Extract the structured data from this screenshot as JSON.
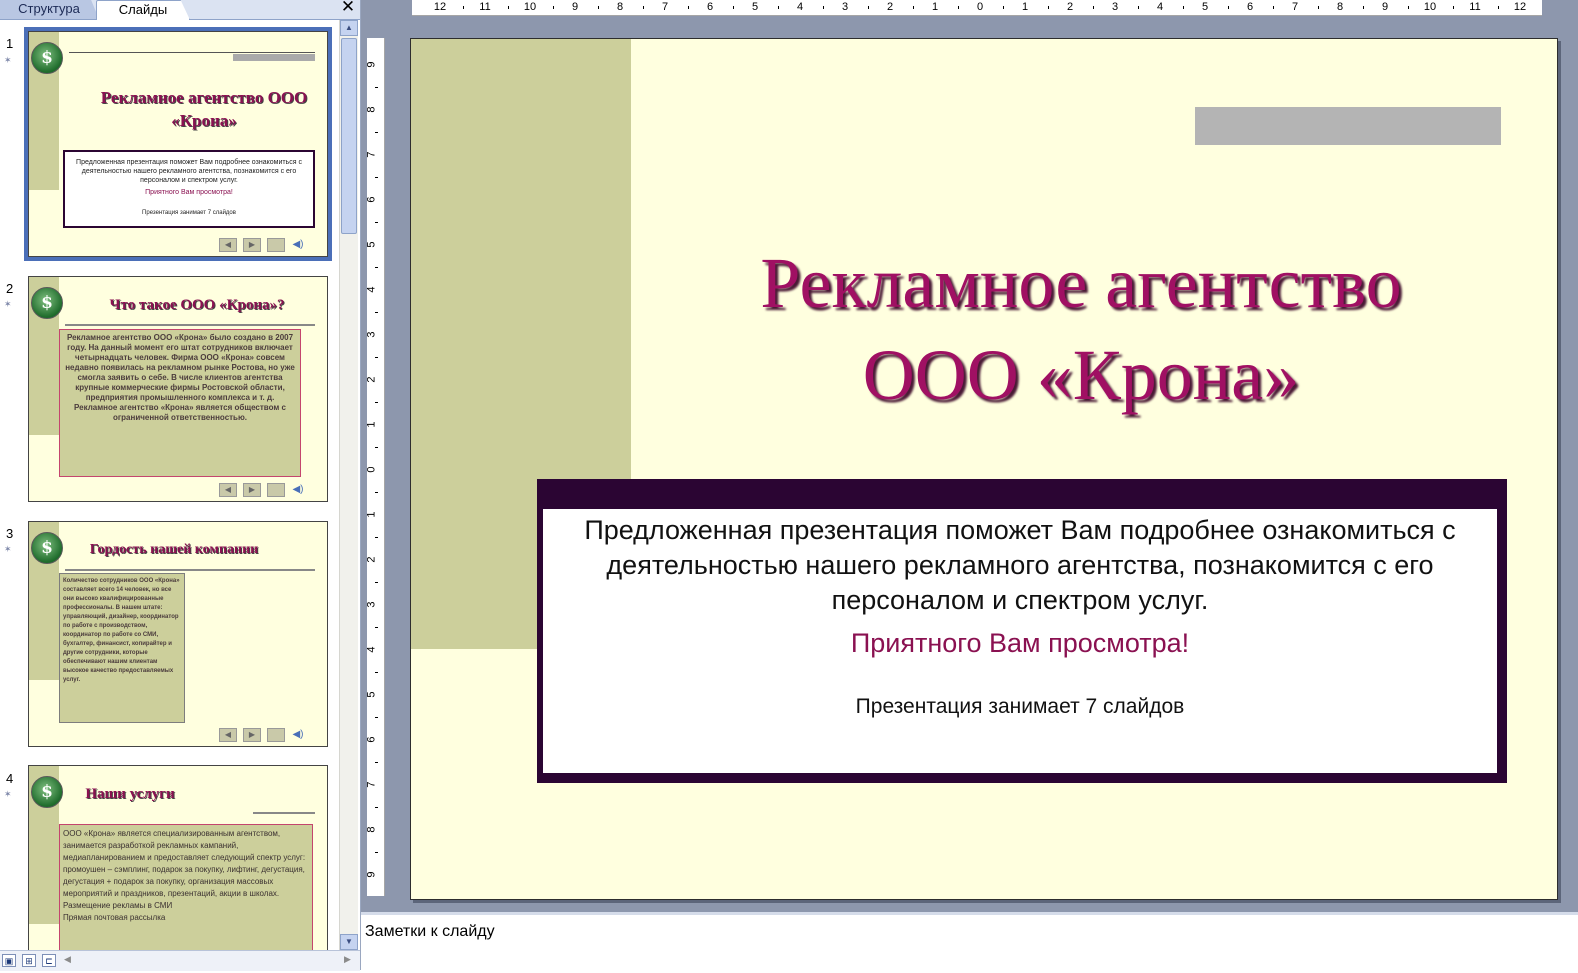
{
  "tabs": {
    "structure": "Структура",
    "slides": "Слайды",
    "close": "✕"
  },
  "thumbnails": [
    {
      "number": "1",
      "title": "Рекламное агентство ООО «Крона»",
      "desc": "Предложенная презентация поможет Вам подробнее ознакомиться с деятельностью нашего рекламного агентства, познакомится с его персоналом и спектром услуг.",
      "invite": "Приятного Вам просмотра!",
      "count": "Презентация занимает 7 слайдов"
    },
    {
      "number": "2",
      "title": "Что такое ООО «Крона»?",
      "body": "Рекламное агентство ООО «Крона» было создано в 2007 году. На данный момент его штат сотрудников включает четырнадцать человек. Фирма ООО «Крона» совсем недавно появилась на рекламном рынке Ростова, но уже смогла заявить о себе. В числе клиентов агентства крупные коммерческие фирмы Ростовской области, предприятия промышленного комплекса и т. д. Рекламное агентство «Крона» является обществом с ограниченной ответственностью."
    },
    {
      "number": "3",
      "title": "Гордость нашей компании",
      "body": "Количество сотрудников ООО «Крона» составляет всего 14 человек, но все они высоко квалифицированные профессионалы. В нашем штате: управляющий, дизайнер, координатор по работе с производством, координатор по работе со СМИ, бухгалтер, финансист, копирайтер и другие сотрудники, которые обеспечивают нашим клиентам высокое качество предоставляемых услуг."
    },
    {
      "number": "4",
      "title": "Наши услуги",
      "bullets": [
        "ООО «Крона» является специализированным агентством, занимается разработкой рекламных кампаний, медиапланированием и предоставляет следующий спектр услуг:",
        "промоушен – сэмплинг, подарок за покупку, лифтинг, дегустация, дегустация + подарок за покупку, организация массовых мероприятий и праздников, презентаций, акции в школах.",
        "Размещение рекламы в СМИ",
        "Прямая почтовая рассылка"
      ]
    }
  ],
  "ruler": {
    "horizontal": [
      "12",
      "11",
      "10",
      "9",
      "8",
      "7",
      "6",
      "5",
      "4",
      "3",
      "2",
      "1",
      "0",
      "1",
      "2",
      "3",
      "4",
      "5",
      "6",
      "7",
      "8",
      "9",
      "10",
      "11",
      "12"
    ],
    "vertical": [
      "9",
      "8",
      "7",
      "6",
      "5",
      "4",
      "3",
      "2",
      "1",
      "0",
      "1",
      "2",
      "3",
      "4",
      "5",
      "6",
      "7",
      "8",
      "9"
    ]
  },
  "slide": {
    "title_line1": "Рекламное агентство",
    "title_line2": "ООО «Крона»",
    "description": "Предложенная презентация поможет Вам подробнее ознакомиться с деятельностью нашего рекламного агентства, познакомится с его персоналом и спектром услуг.",
    "invitation": "Приятного Вам просмотра!",
    "slide_count": "Презентация занимает 7 слайдов",
    "logo_symbol": "$"
  },
  "notes": {
    "placeholder": "Заметки к слайду"
  },
  "icons": {
    "logo": "dollar-stopwatch-icon",
    "slide_transition": "transition-star-icon",
    "nav_prev": "◀",
    "nav_next": "▶",
    "sound": "speaker-icon",
    "scroll_up": "▲",
    "scroll_down": "▼",
    "scroll_left": "◀",
    "scroll_right": "▶"
  },
  "colors": {
    "title": "#a01063",
    "band": "#cccf9b",
    "slide_bg": "#ffffdf",
    "textbox_frame": "#2b0533",
    "selection": "#4b6fb8"
  }
}
